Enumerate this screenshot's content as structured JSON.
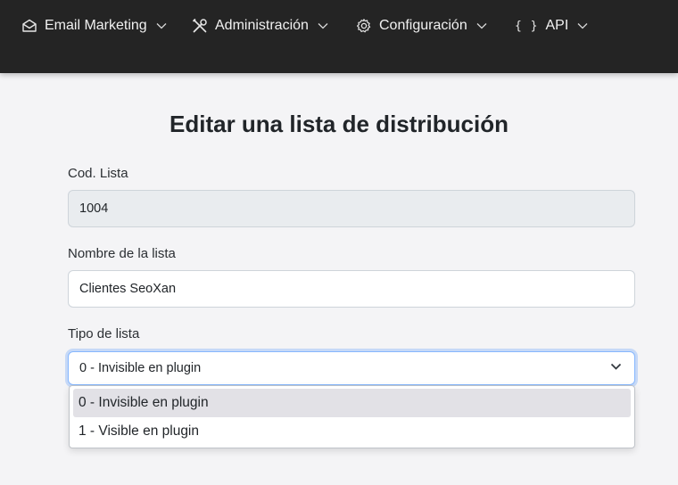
{
  "nav": {
    "items": [
      {
        "label": "Email Marketing",
        "icon": "envelope-icon"
      },
      {
        "label": "Administración",
        "icon": "tools-icon"
      },
      {
        "label": "Configuración",
        "icon": "gear-icon"
      },
      {
        "label": "API",
        "icon": "braces-icon",
        "icon_text": "{ }"
      }
    ]
  },
  "page": {
    "title": "Editar una lista de distribución"
  },
  "form": {
    "cod_lista": {
      "label": "Cod. Lista",
      "value": "1004"
    },
    "nombre": {
      "label": "Nombre de la lista",
      "value": "Clientes SeoXan"
    },
    "tipo": {
      "label": "Tipo de lista",
      "selected": "0 - Invisible en plugin",
      "options": [
        "0 - Invisible en plugin",
        "1 - Visible en plugin"
      ]
    }
  },
  "colors": {
    "navbar": "#242424",
    "background": "#f4f4f6",
    "focus_border": "#86b7fe",
    "option_highlight": "#e2e1e6"
  }
}
